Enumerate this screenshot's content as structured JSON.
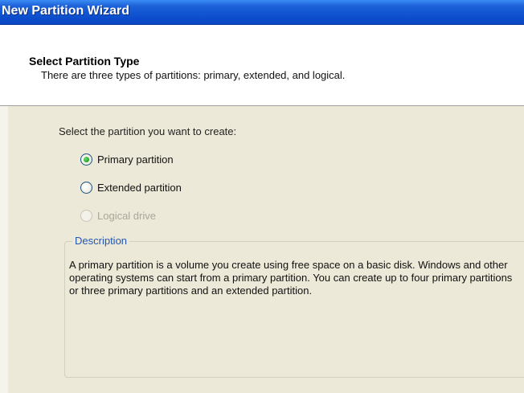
{
  "window": {
    "title": "New Partition Wizard"
  },
  "header": {
    "title": "Select Partition Type",
    "subtitle": "There are three types of partitions: primary, extended, and logical."
  },
  "main": {
    "prompt": "Select the partition you want to create:",
    "options": [
      {
        "label": "Primary partition",
        "selected": true,
        "enabled": true
      },
      {
        "label": "Extended partition",
        "selected": false,
        "enabled": true
      },
      {
        "label": "Logical drive",
        "selected": false,
        "enabled": false
      }
    ],
    "description": {
      "legend": "Description",
      "text": "A primary partition is a volume you create using free space on a basic disk. Windows and other operating systems can start from a primary partition. You can create up to four primary partitions or three primary partitions and an extended partition."
    }
  },
  "colors": {
    "titlebar": "#0d4fce",
    "legend": "#2356b0",
    "selected_dot": "#21a121"
  }
}
